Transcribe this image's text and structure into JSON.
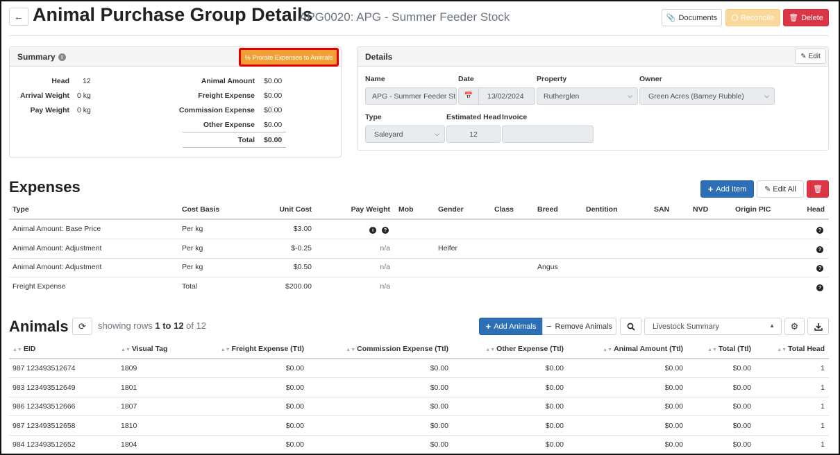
{
  "header": {
    "title": "Animal Purchase Group Details",
    "subtitle": "APG0020: APG - Summer Feeder Stock",
    "documents_label": "Documents",
    "reconcile_label": "Reconcile",
    "delete_label": "Delete"
  },
  "summary": {
    "title": "Summary",
    "prorate_label": "Prorate Expenses to Animals",
    "left": [
      {
        "label": "Head",
        "value": "12"
      },
      {
        "label": "Arrival Weight",
        "value": "0 kg"
      },
      {
        "label": "Pay Weight",
        "value": "0 kg"
      }
    ],
    "right": [
      {
        "label": "Animal Amount",
        "value": "$0.00"
      },
      {
        "label": "Freight Expense",
        "value": "$0.00"
      },
      {
        "label": "Commission Expense",
        "value": "$0.00"
      },
      {
        "label": "Other Expense",
        "value": "$0.00"
      }
    ],
    "total_label": "Total",
    "total_value": "$0.00"
  },
  "details": {
    "title": "Details",
    "edit_label": "Edit",
    "name_label": "Name",
    "name_value": "APG - Summer Feeder St",
    "date_label": "Date",
    "date_value": "13/02/2024",
    "property_label": "Property",
    "property_value": "Rutherglen",
    "owner_label": "Owner",
    "owner_value": "Green Acres (Barney Rubble)",
    "type_label": "Type",
    "type_value": "Saleyard",
    "est_head_label": "Estimated Head",
    "est_head_value": "12",
    "invoice_label": "Invoice",
    "invoice_value": ""
  },
  "expenses": {
    "title": "Expenses",
    "add_item_label": "Add Item",
    "edit_all_label": "Edit All",
    "columns": {
      "type": "Type",
      "cost_basis": "Cost Basis",
      "unit_cost": "Unit Cost",
      "pay_weight": "Pay Weight",
      "mob": "Mob",
      "gender": "Gender",
      "class": "Class",
      "breed": "Breed",
      "dentition": "Dentition",
      "san": "SAN",
      "nvd": "NVD",
      "origin_pic": "Origin PIC",
      "head": "Head"
    },
    "rows": [
      {
        "type": "Animal Amount: Base Price",
        "cost_basis": "Per kg",
        "unit_cost": "$3.00",
        "pay_weight": "",
        "gender": "",
        "breed": ""
      },
      {
        "type": "Animal Amount: Adjustment",
        "cost_basis": "Per kg",
        "unit_cost": "$-0.25",
        "pay_weight": "n/a",
        "gender": "Heifer",
        "breed": ""
      },
      {
        "type": "Animal Amount: Adjustment",
        "cost_basis": "Per kg",
        "unit_cost": "$0.50",
        "pay_weight": "n/a",
        "gender": "",
        "breed": "Angus"
      },
      {
        "type": "Freight Expense",
        "cost_basis": "Total",
        "unit_cost": "$200.00",
        "pay_weight": "n/a",
        "gender": "",
        "breed": ""
      }
    ]
  },
  "animals": {
    "title": "Animals",
    "showing_prefix": "showing rows ",
    "showing_range": "1 to 12",
    "showing_of": " of 12",
    "add_animals_label": "Add Animals",
    "remove_animals_label": "Remove Animals",
    "view_select_value": "Livestock Summary",
    "columns": {
      "eid": "EID",
      "visual_tag": "Visual Tag",
      "freight": "Freight Expense (Ttl)",
      "commission": "Commission Expense (Ttl)",
      "other": "Other Expense (Ttl)",
      "amount": "Animal Amount (Ttl)",
      "total": "Total (Ttl)",
      "total_head": "Total Head"
    },
    "rows": [
      {
        "eid": "987 123493512674",
        "tag": "1809",
        "freight": "$0.00",
        "commission": "$0.00",
        "other": "$0.00",
        "amount": "$0.00",
        "total": "$0.00",
        "head": "1"
      },
      {
        "eid": "983 123493512649",
        "tag": "1801",
        "freight": "$0.00",
        "commission": "$0.00",
        "other": "$0.00",
        "amount": "$0.00",
        "total": "$0.00",
        "head": "1"
      },
      {
        "eid": "986 123493512666",
        "tag": "1807",
        "freight": "$0.00",
        "commission": "$0.00",
        "other": "$0.00",
        "amount": "$0.00",
        "total": "$0.00",
        "head": "1"
      },
      {
        "eid": "987 123493512658",
        "tag": "1810",
        "freight": "$0.00",
        "commission": "$0.00",
        "other": "$0.00",
        "amount": "$0.00",
        "total": "$0.00",
        "head": "1"
      },
      {
        "eid": "984 123493512652",
        "tag": "1804",
        "freight": "$0.00",
        "commission": "$0.00",
        "other": "$0.00",
        "amount": "$0.00",
        "total": "$0.00",
        "head": "1"
      }
    ]
  },
  "colors": {
    "primary": "#2c6fb7",
    "danger": "#dc3545",
    "warning": "#f0a035",
    "highlight": "#e00000"
  }
}
